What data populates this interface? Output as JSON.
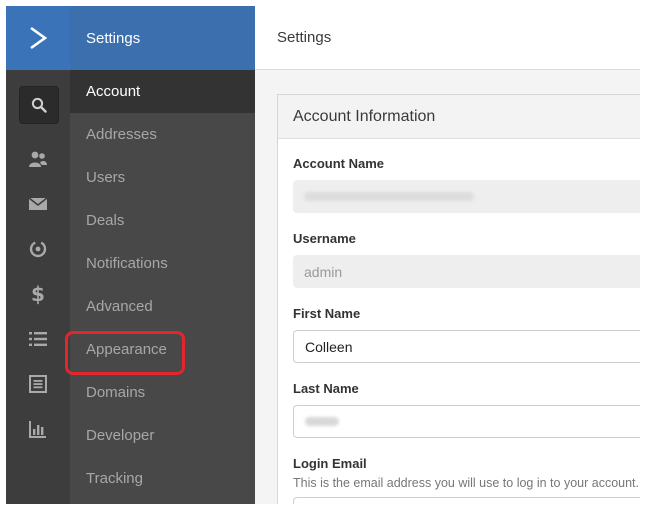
{
  "colors": {
    "logo_bg": "#3b73b9",
    "header_bg": "#3b6fae",
    "rail_bg": "#3d3d3d",
    "sidebar_bg": "#484848",
    "active_bg": "#333333",
    "highlight": "#e2262c"
  },
  "rail": {
    "icons": [
      "activecampaign-logo-icon",
      "search-icon",
      "contacts-icon",
      "campaigns-mail-icon",
      "automations-icon",
      "deals-dollar-icon",
      "lists-icon",
      "forms-icon",
      "reports-icon"
    ]
  },
  "sidebar": {
    "title": "Settings",
    "items": [
      {
        "label": "Account",
        "active": true
      },
      {
        "label": "Addresses",
        "active": false
      },
      {
        "label": "Users",
        "active": false
      },
      {
        "label": "Deals",
        "active": false
      },
      {
        "label": "Notifications",
        "active": false
      },
      {
        "label": "Advanced",
        "active": false
      },
      {
        "label": "Appearance",
        "active": false,
        "highlighted": true
      },
      {
        "label": "Domains",
        "active": false
      },
      {
        "label": "Developer",
        "active": false
      },
      {
        "label": "Tracking",
        "active": false
      }
    ]
  },
  "main": {
    "title": "Settings",
    "card_title": "Account Information",
    "fields": {
      "account_name": {
        "label": "Account Name",
        "value": ""
      },
      "username": {
        "label": "Username",
        "value": "admin"
      },
      "first_name": {
        "label": "First Name",
        "value": "Colleen"
      },
      "last_name": {
        "label": "Last Name",
        "value": ""
      },
      "login_email": {
        "label": "Login Email",
        "help": "This is the email address you will use to log in to your account."
      }
    }
  }
}
